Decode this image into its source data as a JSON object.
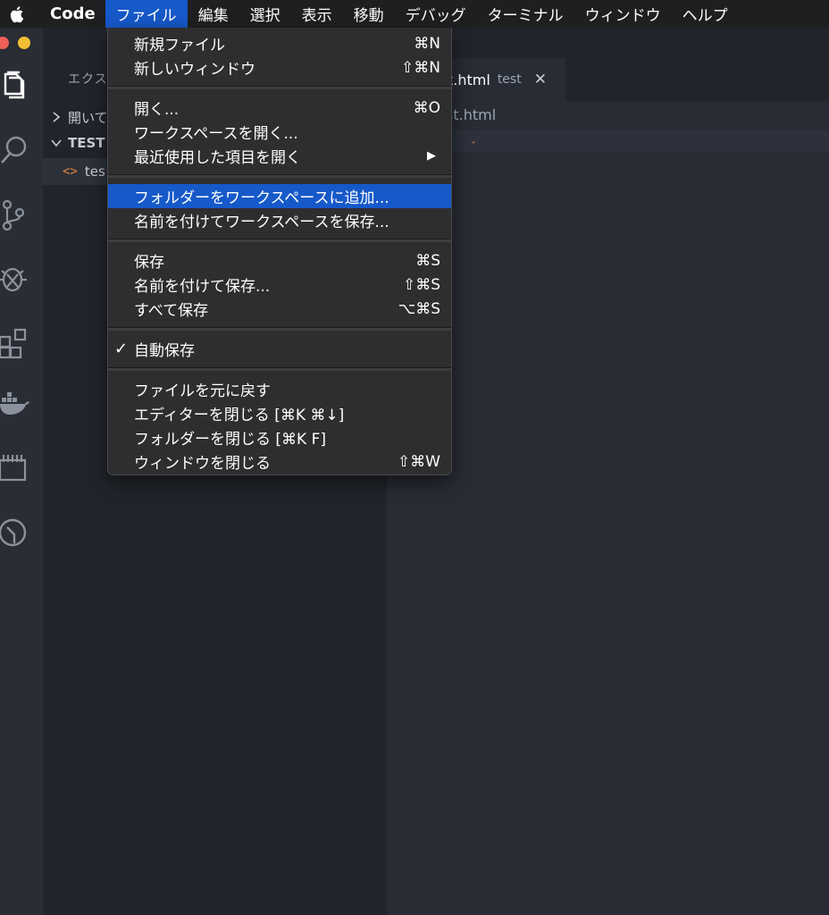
{
  "menubar": {
    "app": "Code",
    "items": [
      "ファイル",
      "編集",
      "選択",
      "表示",
      "移動",
      "デバッグ",
      "ターミナル",
      "ウィンドウ",
      "ヘルプ"
    ],
    "active_index": 0
  },
  "sidebar": {
    "title": "エクス",
    "open_editors": "開いて",
    "folder": "TEST",
    "file": "tes"
  },
  "editor": {
    "tab_name": "t.html",
    "tab_dir": "test",
    "breadcrumb": "st.html"
  },
  "file_menu": {
    "groups": [
      [
        {
          "label": "新規ファイル",
          "shortcut": "⌘N"
        },
        {
          "label": "新しいウィンドウ",
          "shortcut": "⇧⌘N"
        }
      ],
      [
        {
          "label": "開く...",
          "shortcut": "⌘O"
        },
        {
          "label": "ワークスペースを開く...",
          "shortcut": ""
        },
        {
          "label": "最近使用した項目を開く",
          "shortcut": "▶"
        }
      ],
      [
        {
          "label": "フォルダーをワークスペースに追加...",
          "shortcut": "",
          "highlight": true
        },
        {
          "label": "名前を付けてワークスペースを保存...",
          "shortcut": ""
        }
      ],
      [
        {
          "label": "保存",
          "shortcut": "⌘S"
        },
        {
          "label": "名前を付けて保存...",
          "shortcut": "⇧⌘S"
        },
        {
          "label": "すべて保存",
          "shortcut": "⌥⌘S"
        }
      ],
      [
        {
          "label": "自動保存",
          "shortcut": "",
          "checked": true
        }
      ],
      [
        {
          "label": "ファイルを元に戻す",
          "shortcut": ""
        },
        {
          "label": "エディターを閉じる [⌘K ⌘↓]",
          "shortcut": ""
        },
        {
          "label": "フォルダーを閉じる [⌘K F]",
          "shortcut": ""
        },
        {
          "label": "ウィンドウを閉じる",
          "shortcut": "⇧⌘W"
        }
      ]
    ]
  },
  "colors": {
    "menu_highlight": "#1659c9",
    "menubar_bg": "#1f1f21",
    "sidebar_bg": "#21252b",
    "editor_bg": "#282c34"
  }
}
